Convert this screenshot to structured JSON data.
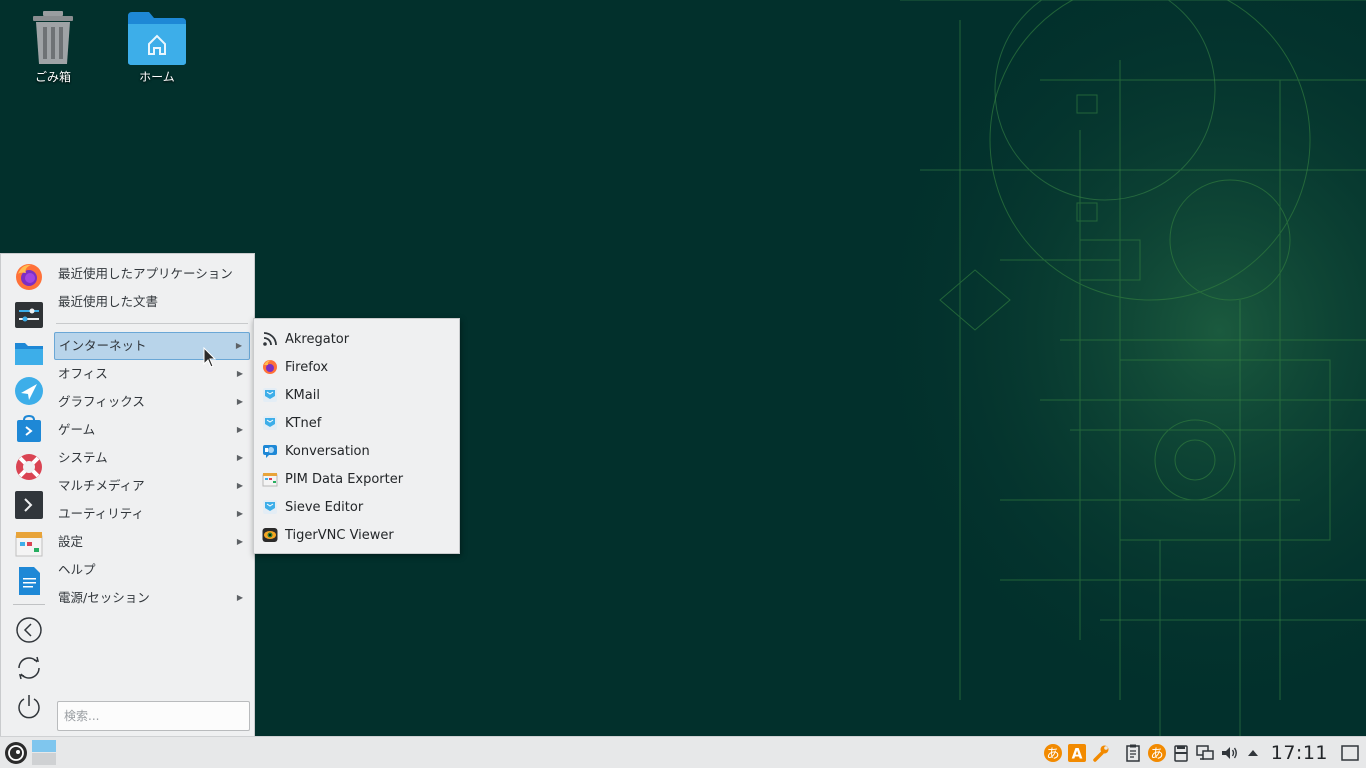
{
  "desktop": {
    "trash_label": "ごみ箱",
    "home_label": "ホーム"
  },
  "start_menu": {
    "recent_apps": "最近使用したアプリケーション",
    "recent_docs": "最近使用した文書",
    "categories": [
      {
        "label": "インターネット",
        "has_submenu": true,
        "highlighted": true
      },
      {
        "label": "オフィス",
        "has_submenu": true
      },
      {
        "label": "グラフィックス",
        "has_submenu": true
      },
      {
        "label": "ゲーム",
        "has_submenu": true
      },
      {
        "label": "システム",
        "has_submenu": true
      },
      {
        "label": "マルチメディア",
        "has_submenu": true
      },
      {
        "label": "ユーティリティ",
        "has_submenu": true
      },
      {
        "label": "設定",
        "has_submenu": true
      },
      {
        "label": "ヘルプ",
        "has_submenu": false
      },
      {
        "label": "電源/セッション",
        "has_submenu": true
      }
    ],
    "favorites": [
      "firefox-icon",
      "settings-icon",
      "file-manager-icon",
      "discover-icon",
      "store-icon",
      "help-lifebuoy-icon",
      "terminal-icon",
      "calendar-icon",
      "text-editor-icon"
    ],
    "session_actions": [
      "logout-icon",
      "switch-user-icon",
      "power-icon"
    ],
    "search_placeholder": "検索..."
  },
  "submenu": {
    "items": [
      {
        "label": "Akregator",
        "icon": "rss-icon"
      },
      {
        "label": "Firefox",
        "icon": "firefox-icon"
      },
      {
        "label": "KMail",
        "icon": "kmail-icon"
      },
      {
        "label": "KTnef",
        "icon": "ktnef-icon"
      },
      {
        "label": "Konversation",
        "icon": "konversation-icon"
      },
      {
        "label": "PIM Data Exporter",
        "icon": "pim-exporter-icon"
      },
      {
        "label": "Sieve Editor",
        "icon": "sieve-editor-icon"
      },
      {
        "label": "TigerVNC Viewer",
        "icon": "tigervnc-icon"
      }
    ]
  },
  "taskbar": {
    "clock": "17:11",
    "tray_icons": [
      "input-method-hiragana-icon",
      "input-method-a-icon",
      "tools-icon",
      "clipboard-icon",
      "input-method-hiragana-icon",
      "storage-icon",
      "network-icon",
      "volume-icon",
      "expand-tray-icon",
      "show-desktop-icon"
    ]
  },
  "colors": {
    "desktop_bg": "#02302c",
    "menu_bg": "#eff0f1",
    "highlight": "#b8d4ea",
    "highlight_border": "#6aa7d6",
    "ime_orange": "#f28a00"
  }
}
